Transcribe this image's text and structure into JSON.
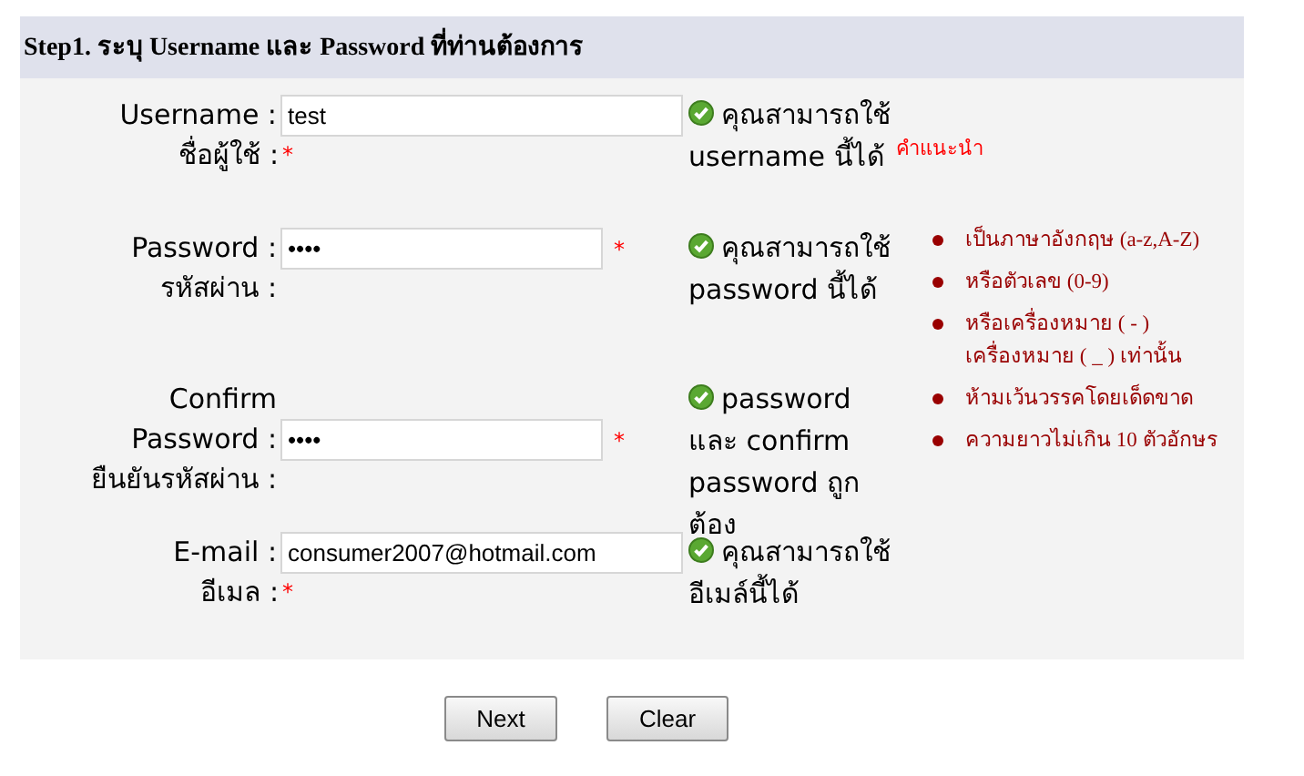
{
  "header": {
    "title": "Step1. ระบุ Username และ Password ที่ท่านต้องการ"
  },
  "fields": [
    {
      "kind": "text",
      "label_lines": [
        "Username :",
        "ชื่อผู้ใช้ :"
      ],
      "value": "test",
      "required_mark": "*",
      "mark_beside_input": false,
      "message": "คุณสามารถใช้ username นี้ได้",
      "hint_link": "คำแนะนำ"
    },
    {
      "kind": "password",
      "label_lines": [
        "Password :",
        "รหัสผ่าน :"
      ],
      "value": "••••",
      "required_mark": "*",
      "mark_beside_input": true,
      "message": "คุณสามารถใช้ password นี้ได้"
    },
    {
      "kind": "password",
      "label_lines": [
        "Confirm",
        "Password :",
        "ยืนยันรหัสผ่าน :"
      ],
      "value": "••••",
      "required_mark": "*",
      "mark_beside_input": true,
      "message": "password และ confirm password ถูกต้อง"
    },
    {
      "kind": "text",
      "label_lines": [
        "E-mail :",
        "อีเมล :"
      ],
      "value": "consumer2007@hotmail.com",
      "required_mark": "*",
      "mark_beside_input": false,
      "message": "คุณสามารถใช้อีเมล์นี้ได้"
    }
  ],
  "tips": [
    "เป็นภาษาอังกฤษ (a-z,A-Z)",
    "หรือตัวเลข (0-9)",
    "หรือเครื่องหมาย ( - ) เครื่องหมาย ( _ ) เท่านั้น",
    "ห้ามเว้นวรรคโดยเด็ดขาด",
    "ความยาวไม่เกิน 10 ตัวอักษร"
  ],
  "buttons": [
    "Next",
    "Clear"
  ]
}
